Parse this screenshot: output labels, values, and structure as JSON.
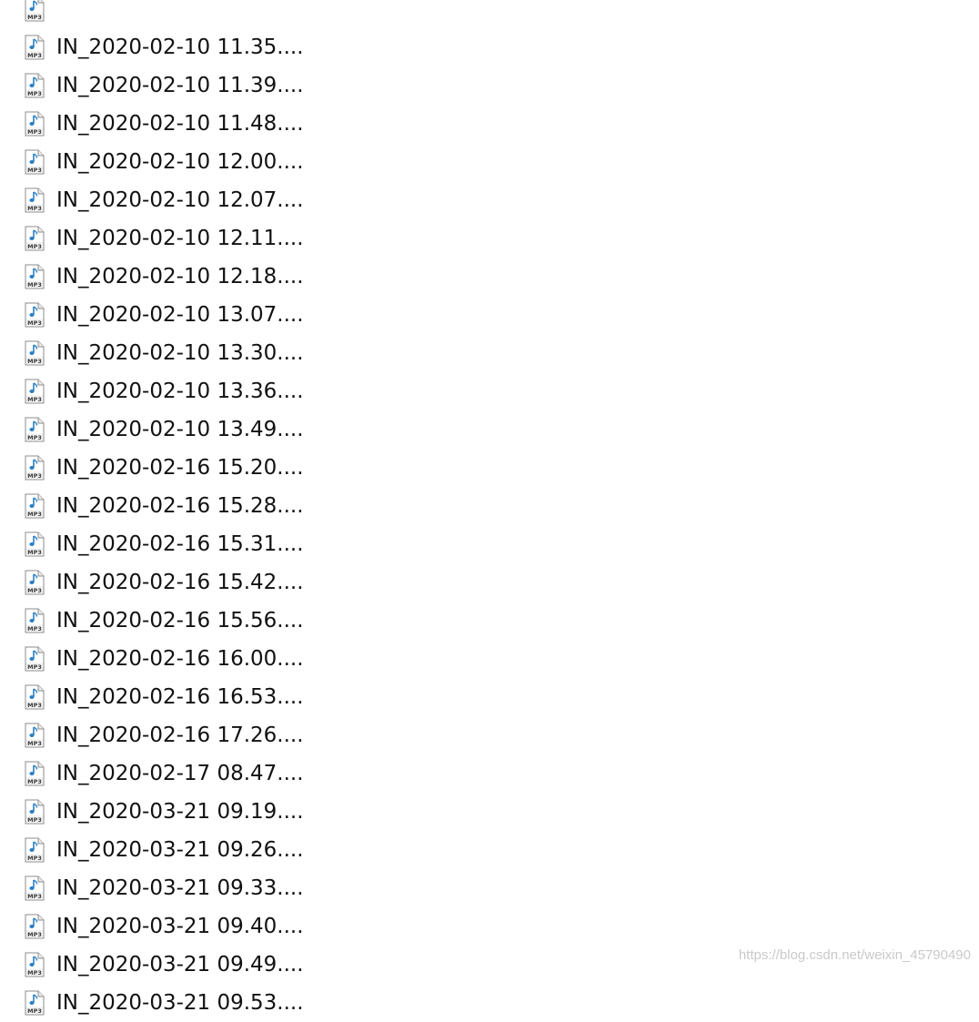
{
  "file_list": {
    "items": [
      {
        "name": "",
        "icon": "mp3-file-icon"
      },
      {
        "name": "IN_2020-02-10 11.35....",
        "icon": "mp3-file-icon"
      },
      {
        "name": "IN_2020-02-10 11.39....",
        "icon": "mp3-file-icon"
      },
      {
        "name": "IN_2020-02-10 11.48....",
        "icon": "mp3-file-icon"
      },
      {
        "name": "IN_2020-02-10 12.00....",
        "icon": "mp3-file-icon"
      },
      {
        "name": "IN_2020-02-10 12.07....",
        "icon": "mp3-file-icon"
      },
      {
        "name": "IN_2020-02-10 12.11....",
        "icon": "mp3-file-icon"
      },
      {
        "name": "IN_2020-02-10 12.18....",
        "icon": "mp3-file-icon"
      },
      {
        "name": "IN_2020-02-10 13.07....",
        "icon": "mp3-file-icon"
      },
      {
        "name": "IN_2020-02-10 13.30....",
        "icon": "mp3-file-icon"
      },
      {
        "name": "IN_2020-02-10 13.36....",
        "icon": "mp3-file-icon"
      },
      {
        "name": "IN_2020-02-10 13.49....",
        "icon": "mp3-file-icon"
      },
      {
        "name": "IN_2020-02-16 15.20....",
        "icon": "mp3-file-icon"
      },
      {
        "name": "IN_2020-02-16 15.28....",
        "icon": "mp3-file-icon"
      },
      {
        "name": "IN_2020-02-16 15.31....",
        "icon": "mp3-file-icon"
      },
      {
        "name": "IN_2020-02-16 15.42....",
        "icon": "mp3-file-icon"
      },
      {
        "name": "IN_2020-02-16 15.56....",
        "icon": "mp3-file-icon"
      },
      {
        "name": "IN_2020-02-16 16.00....",
        "icon": "mp3-file-icon"
      },
      {
        "name": "IN_2020-02-16 16.53....",
        "icon": "mp3-file-icon"
      },
      {
        "name": "IN_2020-02-16 17.26....",
        "icon": "mp3-file-icon"
      },
      {
        "name": "IN_2020-02-17 08.47....",
        "icon": "mp3-file-icon"
      },
      {
        "name": "IN_2020-03-21 09.19....",
        "icon": "mp3-file-icon"
      },
      {
        "name": "IN_2020-03-21 09.26....",
        "icon": "mp3-file-icon"
      },
      {
        "name": "IN_2020-03-21 09.33....",
        "icon": "mp3-file-icon"
      },
      {
        "name": "IN_2020-03-21 09.40....",
        "icon": "mp3-file-icon"
      },
      {
        "name": "IN_2020-03-21 09.49....",
        "icon": "mp3-file-icon"
      },
      {
        "name": "IN_2020-03-21 09.53....",
        "icon": "mp3-file-icon"
      }
    ]
  },
  "watermark": {
    "text": "https://blog.csdn.net/weixin_45790490"
  },
  "colors": {
    "background": "#ffffff",
    "text": "#111111",
    "icon_accent": "#2a7fc4",
    "watermark": "#c9c9c9"
  }
}
